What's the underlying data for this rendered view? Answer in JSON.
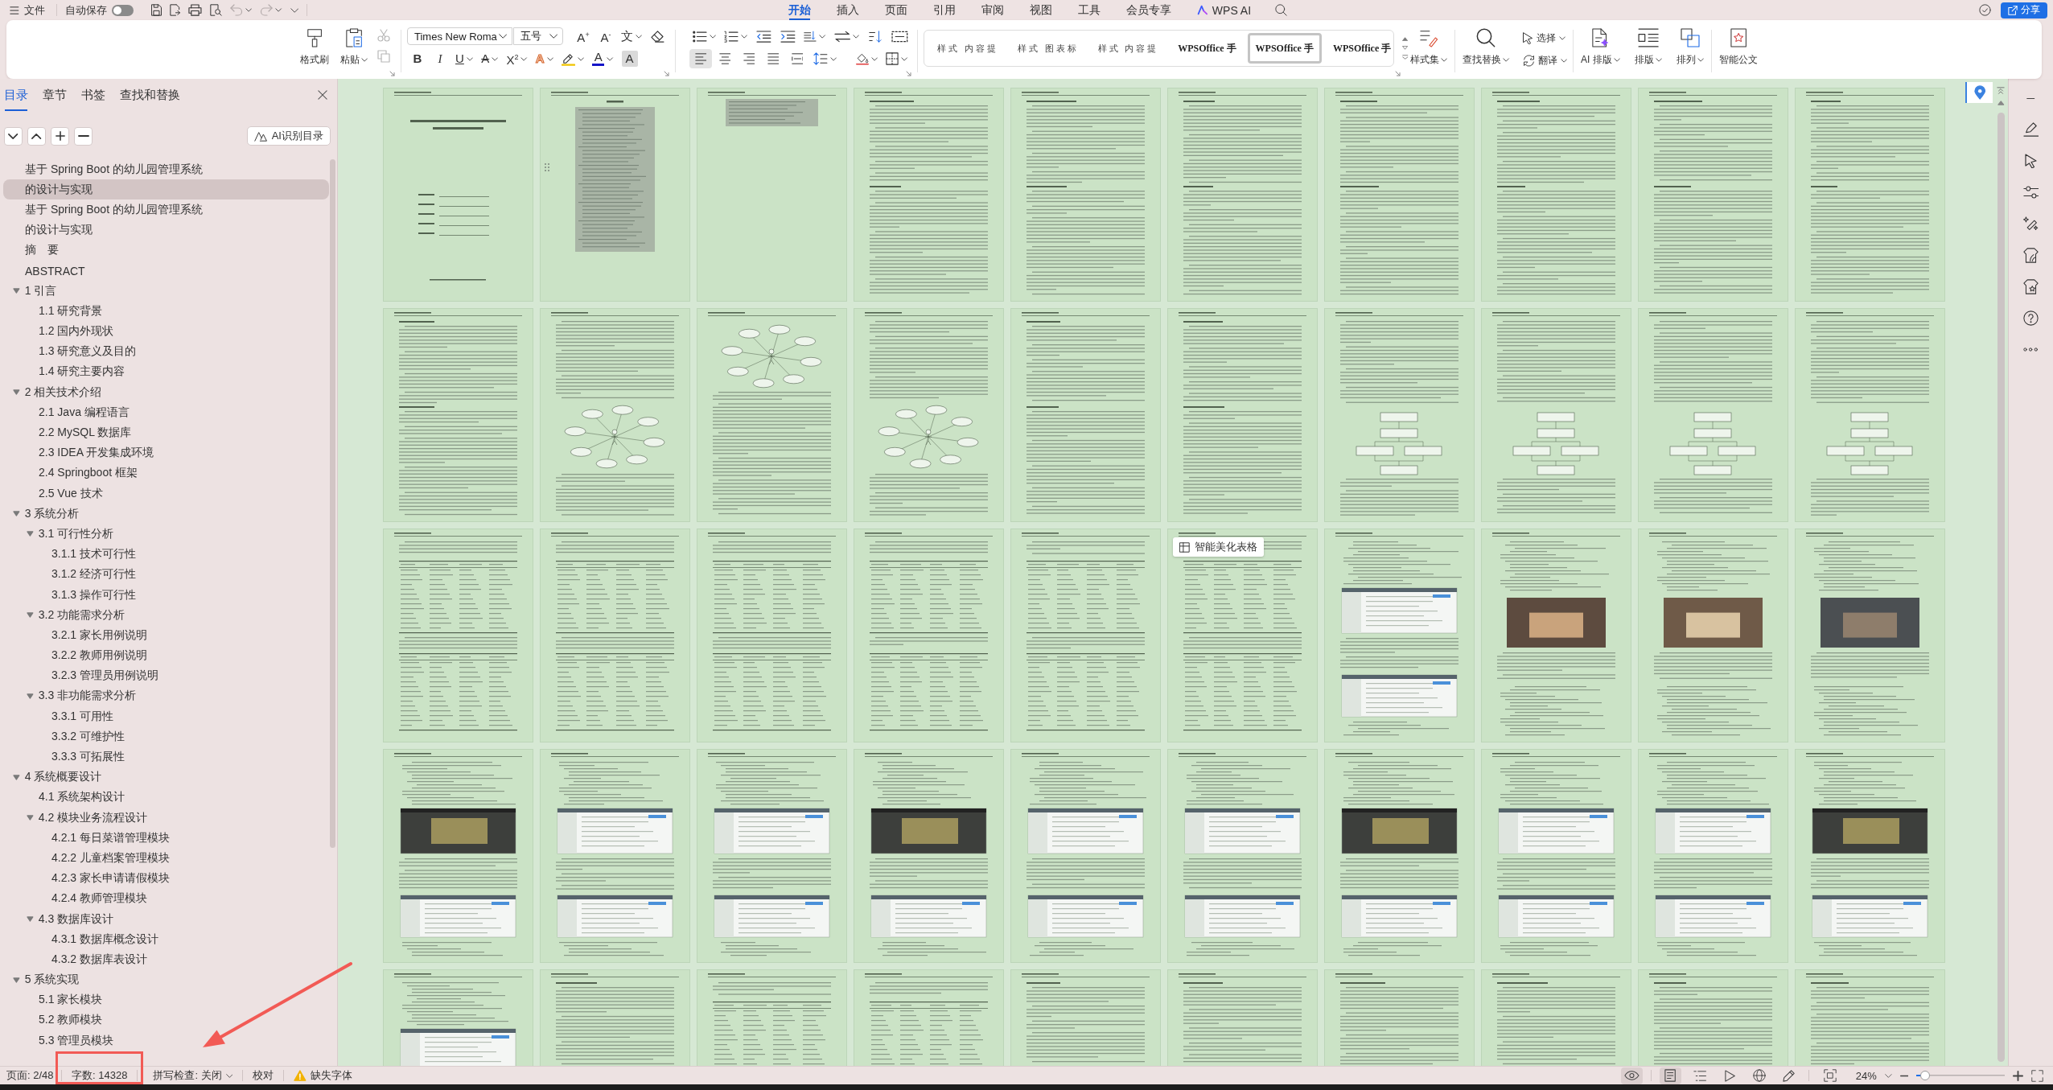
{
  "top_bar": {
    "menu": "文件",
    "autosave": {
      "label": "自动保存",
      "on": false
    },
    "quick_access": [
      {
        "disabled": false,
        "dropdown": false
      },
      {
        "disabled": false,
        "dropdown": false
      },
      {
        "disabled": false,
        "dropdown": false
      },
      {
        "disabled": false,
        "dropdown": false
      },
      {
        "disabled": true,
        "dropdown": true
      },
      {
        "disabled": true,
        "dropdown": true
      }
    ],
    "tabs": [
      {
        "label": "开始",
        "kind": "text",
        "selected": true
      },
      {
        "label": "插入",
        "kind": "text",
        "selected": false
      },
      {
        "label": "页面",
        "kind": "text",
        "selected": false
      },
      {
        "label": "引用",
        "kind": "text",
        "selected": false
      },
      {
        "label": "审阅",
        "kind": "text",
        "selected": false
      },
      {
        "label": "视图",
        "kind": "text",
        "selected": false
      },
      {
        "label": "工具",
        "kind": "text",
        "selected": false
      },
      {
        "label": "会员专享",
        "kind": "text",
        "selected": false
      },
      {
        "label": "WPS AI",
        "kind": "ai",
        "selected": false
      }
    ],
    "share_button": "分享"
  },
  "ribbon": {
    "clipboard": [
      {
        "label": "格式刷",
        "dropdown": false
      },
      {
        "label": "粘贴",
        "dropdown": true
      }
    ],
    "edit_tools": [
      {
        "disabled": true
      },
      {
        "disabled": true
      }
    ],
    "font": {
      "name": "Times New Roma",
      "size": "五号",
      "row_1": [
        {
          "kind": "text",
          "label": "A$^{+}$",
          "dropdown": false
        },
        {
          "kind": "text",
          "label": "A$^{-}$",
          "dropdown": false
        },
        {
          "kind": "text",
          "label": "文",
          "dropdown": true
        },
        {
          "kind": "eraser",
          "dropdown": false
        }
      ],
      "row_2": [
        {
          "kind": "bold",
          "label": "B",
          "dropdown": false
        },
        {
          "kind": "italic",
          "label": "I",
          "dropdown": false
        },
        {
          "kind": "underline",
          "label": "U",
          "dropdown": true
        },
        {
          "kind": "strike",
          "label": "A",
          "dropdown": true
        },
        {
          "kind": "text",
          "label": "X$^{2}$",
          "dropdown": true
        },
        {
          "kind": "effect",
          "label": "A",
          "dropdown": true
        },
        {
          "kind": "highlighter",
          "dropdown": true
        },
        {
          "kind": "color",
          "label": "A",
          "dropdown": true
        },
        {
          "kind": "shade",
          "label": "A",
          "dropdown": false
        }
      ]
    },
    "paragraph": {
      "row_1": [
        {
          "dropdown": true
        },
        {
          "dropdown": true
        },
        {
          "dropdown": false
        },
        {
          "dropdown": false
        },
        {
          "dropdown": true
        },
        {
          "dropdown": true
        },
        {
          "dropdown": false
        },
        {
          "dropdown": false
        }
      ],
      "alignment": [
        {
          "selected": true
        },
        {
          "selected": false
        },
        {
          "selected": false
        },
        {
          "selected": false
        },
        {
          "selected": false
        }
      ],
      "row_2": [
        {
          "dropdown": true
        },
        {
          "dropdown": true
        },
        {
          "dropdown": true
        }
      ]
    },
    "styles": [
      {
        "label": "样式 内容提",
        "kind": "spaced",
        "selected": false
      },
      {
        "label": "样式 图表标",
        "kind": "spaced",
        "selected": false
      },
      {
        "label": "样式 内容提",
        "kind": "spaced",
        "selected": false
      },
      {
        "label": "WPSOffice 手",
        "kind": "bold",
        "selected": false
      },
      {
        "label": "WPSOffice 手",
        "kind": "bold",
        "selected": true
      },
      {
        "label": "WPSOffice 手",
        "kind": "bold",
        "selected": false
      }
    ],
    "command_groups": [
      [
        {
          "label": "样式集",
          "kind": "large",
          "dropdown": true
        }
      ],
      [
        {
          "label": "查找替换",
          "kind": "large",
          "dropdown": true
        },
        {
          "label": "选择",
          "kind": "small",
          "dropdown": true
        },
        {
          "label": "翻译",
          "kind": "small",
          "dropdown": true
        }
      ],
      [
        {
          "label": "AI 排版",
          "kind": "large",
          "dropdown": true
        },
        {
          "label": "排版",
          "kind": "large",
          "dropdown": true
        },
        {
          "label": "排列",
          "kind": "large",
          "dropdown": true
        }
      ],
      [
        {
          "label": "智能公文",
          "kind": "large",
          "dropdown": false
        }
      ]
    ]
  },
  "sidebar": {
    "tabs": [
      {
        "label": "目录",
        "selected": true
      },
      {
        "label": "章节",
        "selected": false
      },
      {
        "label": "书签",
        "selected": false
      },
      {
        "label": "查找和替换",
        "selected": false
      }
    ],
    "ai_button": "AI识别目录",
    "outline": [
      {
        "text": "基于 Spring Boot 的幼儿园管理系统",
        "selected": false
      },
      {
        "text": "的设计与实现",
        "selected": true
      },
      {
        "text": "基于 Spring Boot 的幼儿园管理系统",
        "selected": false
      },
      {
        "text": "的设计与实现",
        "selected": false
      },
      {
        "text": "摘　要",
        "selected": false
      },
      {
        "text": "ABSTRACT",
        "selected": false
      },
      {
        "text": "1 引言",
        "selected": false,
        "expanded": true,
        "children": [
          {
            "text": "1.1 研究背景",
            "selected": false
          },
          {
            "text": "1.2 国内外现状",
            "selected": false
          },
          {
            "text": "1.3 研究意义及目的",
            "selected": false
          },
          {
            "text": "1.4 研究主要内容",
            "selected": false
          }
        ]
      },
      {
        "text": "2 相关技术介绍",
        "selected": false,
        "expanded": true,
        "children": [
          {
            "text": "2.1 Java 编程语言",
            "selected": false
          },
          {
            "text": "2.2 MySQL 数据库",
            "selected": false
          },
          {
            "text": "2.3 IDEA 开发集成环境",
            "selected": false
          },
          {
            "text": "2.4 Springboot 框架",
            "selected": false
          },
          {
            "text": "2.5 Vue 技术",
            "selected": false
          }
        ]
      },
      {
        "text": "3 系统分析",
        "selected": false,
        "expanded": true,
        "children": [
          {
            "text": "3.1 可行性分析",
            "selected": false,
            "expanded": true,
            "children": [
              {
                "text": "3.1.1 技术可行性",
                "selected": false
              },
              {
                "text": "3.1.2 经济可行性",
                "selected": false
              },
              {
                "text": "3.1.3 操作可行性",
                "selected": false
              }
            ]
          },
          {
            "text": "3.2 功能需求分析",
            "selected": false,
            "expanded": true,
            "children": [
              {
                "text": "3.2.1 家长用例说明",
                "selected": false
              },
              {
                "text": "3.2.2 教师用例说明",
                "selected": false
              },
              {
                "text": "3.2.3 管理员用例说明",
                "selected": false
              }
            ]
          },
          {
            "text": "3.3 非功能需求分析",
            "selected": false,
            "expanded": true,
            "children": [
              {
                "text": "3.3.1 可用性",
                "selected": false
              },
              {
                "text": "3.3.2 可维护性",
                "selected": false
              },
              {
                "text": "3.3.3 可拓展性",
                "selected": false
              }
            ]
          }
        ]
      },
      {
        "text": "4 系统概要设计",
        "selected": false,
        "expanded": true,
        "children": [
          {
            "text": "4.1 系统架构设计",
            "selected": false
          },
          {
            "text": "4.2 模块业务流程设计",
            "selected": false,
            "expanded": true,
            "children": [
              {
                "text": "4.2.1 每日菜谱管理模块",
                "selected": false
              },
              {
                "text": "4.2.2 儿童档案管理模块",
                "selected": false
              },
              {
                "text": "4.2.3 家长申请请假模块",
                "selected": false
              },
              {
                "text": "4.2.4 教师管理模块",
                "selected": false
              }
            ]
          },
          {
            "text": "4.3 数据库设计",
            "selected": false,
            "expanded": true,
            "children": [
              {
                "text": "4.3.1 数据库概念设计",
                "selected": false
              },
              {
                "text": "4.3.2 数据库表设计",
                "selected": false
              }
            ]
          }
        ]
      },
      {
        "text": "5 系统实现",
        "selected": false,
        "expanded": true,
        "children": [
          {
            "text": "5.1 家长模块",
            "selected": false
          },
          {
            "text": "5.2 教师模块",
            "selected": false
          },
          {
            "text": "5.3 管理员模块",
            "selected": false
          }
        ]
      }
    ]
  },
  "document": {
    "pages": [
      {
        "kind": "cover"
      },
      {
        "kind": "contents"
      },
      {
        "kind": "contentsend"
      },
      {
        "kind": "text"
      },
      {
        "kind": "text"
      },
      {
        "kind": "text"
      },
      {
        "kind": "text"
      },
      {
        "kind": "text"
      },
      {
        "kind": "text"
      },
      {
        "kind": "text"
      },
      {
        "kind": "text"
      },
      {
        "kind": "figure"
      },
      {
        "kind": "figure"
      },
      {
        "kind": "figure"
      },
      {
        "kind": "text"
      },
      {
        "kind": "text"
      },
      {
        "kind": "flow"
      },
      {
        "kind": "flow"
      },
      {
        "kind": "flow"
      },
      {
        "kind": "flow"
      },
      {
        "kind": "table"
      },
      {
        "kind": "table"
      },
      {
        "kind": "table"
      },
      {
        "kind": "table"
      },
      {
        "kind": "table"
      },
      {
        "kind": "table"
      },
      {
        "kind": "screenshot"
      },
      {
        "kind": "photo"
      },
      {
        "kind": "photo"
      },
      {
        "kind": "photo"
      },
      {
        "kind": "screenshot"
      },
      {
        "kind": "screenshot"
      },
      {
        "kind": "screenshot"
      },
      {
        "kind": "screenshot"
      },
      {
        "kind": "screenshot"
      },
      {
        "kind": "screenshot"
      },
      {
        "kind": "screenshot"
      },
      {
        "kind": "screenshot"
      },
      {
        "kind": "screenshot"
      },
      {
        "kind": "screenshot"
      },
      {
        "kind": "screenshot"
      },
      {
        "kind": "text"
      },
      {
        "kind": "table"
      },
      {
        "kind": "table"
      },
      {
        "kind": "text"
      },
      {
        "kind": "text"
      },
      {
        "kind": "text"
      },
      {
        "kind": "text"
      },
      {
        "kind": "text"
      },
      {
        "kind": "text"
      }
    ],
    "tooltip": "智能美化表格"
  },
  "status_bar": {
    "page": "页面: 2/48",
    "word_count": "字数: 14328",
    "spell_check": "拼写检查: 关闭",
    "proofread": "校对",
    "missing_fonts": "缺失字体",
    "eye_care": {
      "on": true
    },
    "views": [
      {
        "selected": true
      },
      {
        "selected": false
      },
      {
        "selected": false
      },
      {
        "selected": false
      },
      {
        "selected": false
      }
    ],
    "zoom": {
      "reading": "24%",
      "level": 0.1
    }
  }
}
